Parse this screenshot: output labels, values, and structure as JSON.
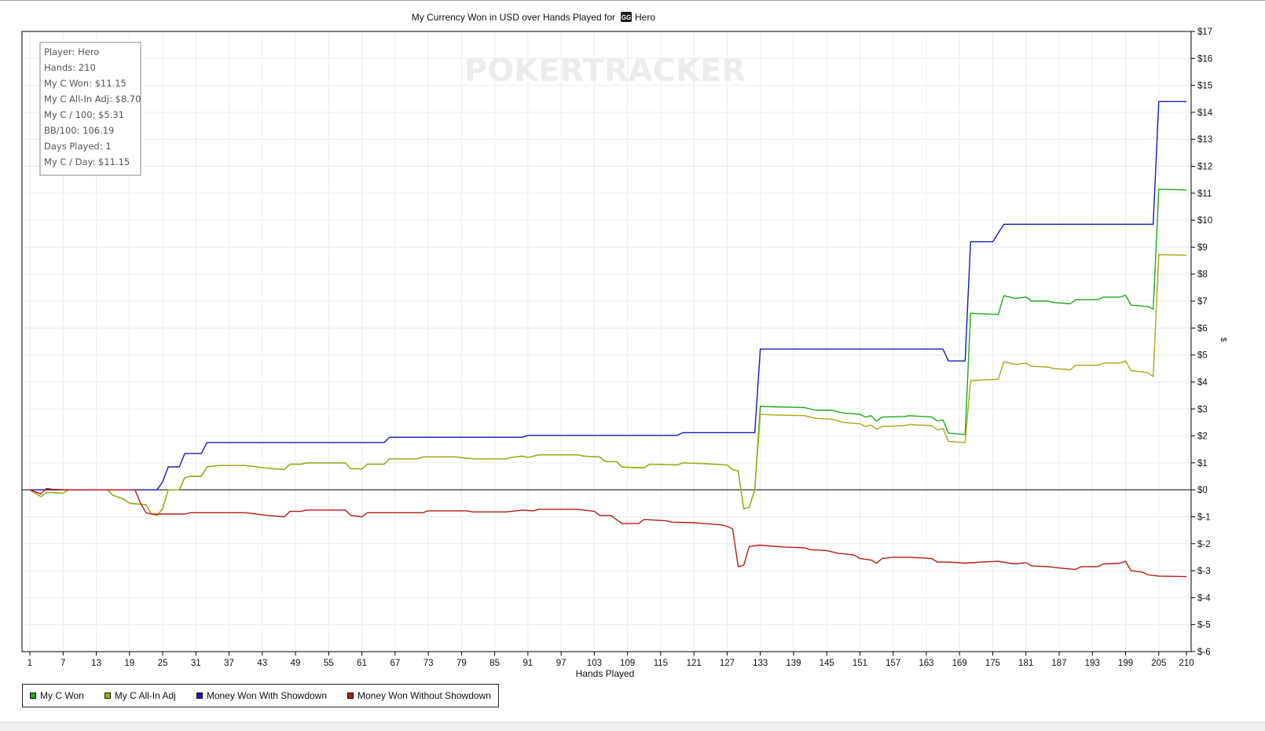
{
  "chart_data": {
    "type": "line",
    "title": "My Currency Won in USD over Hands Played for",
    "title_player": "Hero",
    "watermark": "POKERTRACKER",
    "xlabel": "Hands Played",
    "ylabel": "$",
    "xlim": [
      1,
      210
    ],
    "ylim": [
      -6,
      17
    ],
    "x_ticks": [
      1,
      7,
      13,
      19,
      25,
      31,
      37,
      43,
      49,
      55,
      61,
      67,
      73,
      79,
      85,
      91,
      97,
      103,
      109,
      115,
      121,
      127,
      133,
      139,
      145,
      151,
      157,
      163,
      169,
      175,
      181,
      187,
      193,
      199,
      205,
      210
    ],
    "y_ticks": [
      -6,
      -5,
      -4,
      -3,
      -2,
      -1,
      0,
      1,
      2,
      3,
      4,
      5,
      6,
      7,
      8,
      9,
      10,
      11,
      12,
      13,
      14,
      15,
      16,
      17
    ],
    "y_tick_labels": [
      "$-6",
      "$-5",
      "$-4",
      "$-3",
      "$-2",
      "$-1",
      "$0",
      "$1",
      "$2",
      "$3",
      "$4",
      "$5",
      "$6",
      "$7",
      "$8",
      "$9",
      "$10",
      "$11",
      "$12",
      "$13",
      "$14",
      "$15",
      "$16",
      "$17"
    ],
    "x_tick_labels": [
      "1",
      "7",
      "13",
      "19",
      "25",
      "31",
      "37",
      "43",
      "49",
      "55",
      "61",
      "67",
      "73",
      "79",
      "85",
      "91",
      "97",
      "103",
      "109",
      "115",
      "121",
      "127",
      "133",
      "139",
      "145",
      "151",
      "157",
      "163",
      "169",
      "175",
      "181",
      "187",
      "193",
      "199",
      "205",
      "210"
    ],
    "grid": true,
    "legend_position": "bottom-left",
    "stats_box": [
      "Player: Hero",
      "Hands: 210",
      "My C Won: $11.15",
      "My C All-In Adj: $8.70",
      "My C / 100: $5.31",
      "BB/100: 106.19",
      "Days Played: 1",
      "My C / Day: $11.15"
    ],
    "series": [
      {
        "name": "My C Won",
        "color": "#1fa81f",
        "points": [
          [
            1,
            0
          ],
          [
            3,
            -0.25
          ],
          [
            4,
            -0.1
          ],
          [
            7,
            -0.12
          ],
          [
            8,
            0
          ],
          [
            15,
            0
          ],
          [
            16,
            -0.2
          ],
          [
            18,
            -0.35
          ],
          [
            19,
            -0.5
          ],
          [
            22,
            -0.55
          ],
          [
            23,
            -0.9
          ],
          [
            24,
            -0.95
          ],
          [
            25,
            -0.7
          ],
          [
            26,
            0
          ],
          [
            28,
            0
          ],
          [
            29,
            0.45
          ],
          [
            30,
            0.5
          ],
          [
            32,
            0.5
          ],
          [
            33,
            0.85
          ],
          [
            35,
            0.9
          ],
          [
            40,
            0.9
          ],
          [
            44,
            0.8
          ],
          [
            47,
            0.75
          ],
          [
            48,
            0.95
          ],
          [
            50,
            0.95
          ],
          [
            51,
            1
          ],
          [
            58,
            1
          ],
          [
            59,
            0.78
          ],
          [
            61,
            0.78
          ],
          [
            62,
            0.95
          ],
          [
            65,
            0.95
          ],
          [
            66,
            1.15
          ],
          [
            71,
            1.15
          ],
          [
            72,
            1.22
          ],
          [
            78,
            1.22
          ],
          [
            81,
            1.15
          ],
          [
            87,
            1.15
          ],
          [
            88,
            1.2
          ],
          [
            90,
            1.25
          ],
          [
            91,
            1.2
          ],
          [
            93,
            1.3
          ],
          [
            100,
            1.3
          ],
          [
            101,
            1.25
          ],
          [
            104,
            1.22
          ],
          [
            105,
            1.05
          ],
          [
            107,
            1.05
          ],
          [
            108,
            0.85
          ],
          [
            110,
            0.82
          ],
          [
            112,
            0.82
          ],
          [
            113,
            0.95
          ],
          [
            118,
            0.92
          ],
          [
            119,
            1.0
          ],
          [
            122,
            0.98
          ],
          [
            127,
            0.92
          ],
          [
            128,
            0.75
          ],
          [
            129,
            0.7
          ],
          [
            130,
            -0.7
          ],
          [
            131,
            -0.65
          ],
          [
            132,
            0
          ],
          [
            133,
            3.1
          ],
          [
            135,
            3.08
          ],
          [
            141,
            3.05
          ],
          [
            143,
            2.95
          ],
          [
            146,
            2.95
          ],
          [
            148,
            2.85
          ],
          [
            151,
            2.8
          ],
          [
            152,
            2.7
          ],
          [
            153,
            2.75
          ],
          [
            154,
            2.55
          ],
          [
            155,
            2.7
          ],
          [
            159,
            2.72
          ],
          [
            160,
            2.75
          ],
          [
            164,
            2.7
          ],
          [
            165,
            2.55
          ],
          [
            166,
            2.6
          ],
          [
            167,
            2.1
          ],
          [
            170,
            2.05
          ],
          [
            171,
            6.55
          ],
          [
            176,
            6.5
          ],
          [
            177,
            7.2
          ],
          [
            179,
            7.1
          ],
          [
            181,
            7.15
          ],
          [
            182,
            7.0
          ],
          [
            185,
            7.0
          ],
          [
            186,
            6.95
          ],
          [
            189,
            6.9
          ],
          [
            190,
            7.05
          ],
          [
            194,
            7.05
          ],
          [
            195,
            7.15
          ],
          [
            198,
            7.15
          ],
          [
            199,
            7.22
          ],
          [
            200,
            6.85
          ],
          [
            203,
            6.8
          ],
          [
            204,
            6.7
          ],
          [
            205,
            11.15
          ],
          [
            210,
            11.12
          ]
        ]
      },
      {
        "name": "My C All-In Adj",
        "color": "#a8a812",
        "points": [
          [
            1,
            0
          ],
          [
            3,
            -0.25
          ],
          [
            4,
            -0.1
          ],
          [
            7,
            -0.12
          ],
          [
            8,
            0
          ],
          [
            15,
            0
          ],
          [
            16,
            -0.2
          ],
          [
            18,
            -0.35
          ],
          [
            19,
            -0.5
          ],
          [
            22,
            -0.55
          ],
          [
            23,
            -0.9
          ],
          [
            24,
            -0.95
          ],
          [
            25,
            -0.7
          ],
          [
            26,
            0
          ],
          [
            28,
            0
          ],
          [
            29,
            0.45
          ],
          [
            30,
            0.5
          ],
          [
            32,
            0.5
          ],
          [
            33,
            0.85
          ],
          [
            35,
            0.9
          ],
          [
            40,
            0.9
          ],
          [
            44,
            0.8
          ],
          [
            47,
            0.75
          ],
          [
            48,
            0.95
          ],
          [
            50,
            0.95
          ],
          [
            51,
            1
          ],
          [
            58,
            1
          ],
          [
            59,
            0.78
          ],
          [
            61,
            0.78
          ],
          [
            62,
            0.95
          ],
          [
            65,
            0.95
          ],
          [
            66,
            1.15
          ],
          [
            71,
            1.15
          ],
          [
            72,
            1.22
          ],
          [
            78,
            1.22
          ],
          [
            81,
            1.15
          ],
          [
            87,
            1.15
          ],
          [
            88,
            1.2
          ],
          [
            90,
            1.25
          ],
          [
            91,
            1.2
          ],
          [
            93,
            1.3
          ],
          [
            100,
            1.3
          ],
          [
            101,
            1.25
          ],
          [
            104,
            1.22
          ],
          [
            105,
            1.05
          ],
          [
            107,
            1.05
          ],
          [
            108,
            0.85
          ],
          [
            110,
            0.82
          ],
          [
            112,
            0.82
          ],
          [
            113,
            0.95
          ],
          [
            118,
            0.92
          ],
          [
            119,
            1.0
          ],
          [
            122,
            0.98
          ],
          [
            127,
            0.92
          ],
          [
            128,
            0.75
          ],
          [
            129,
            0.7
          ],
          [
            130,
            -0.7
          ],
          [
            131,
            -0.65
          ],
          [
            132,
            0
          ],
          [
            133,
            2.8
          ],
          [
            135,
            2.78
          ],
          [
            141,
            2.75
          ],
          [
            143,
            2.65
          ],
          [
            146,
            2.62
          ],
          [
            148,
            2.5
          ],
          [
            151,
            2.45
          ],
          [
            152,
            2.35
          ],
          [
            153,
            2.4
          ],
          [
            154,
            2.25
          ],
          [
            155,
            2.35
          ],
          [
            159,
            2.38
          ],
          [
            160,
            2.42
          ],
          [
            164,
            2.38
          ],
          [
            165,
            2.22
          ],
          [
            166,
            2.28
          ],
          [
            167,
            1.8
          ],
          [
            170,
            1.75
          ],
          [
            171,
            4.05
          ],
          [
            176,
            4.1
          ],
          [
            177,
            4.75
          ],
          [
            179,
            4.65
          ],
          [
            181,
            4.7
          ],
          [
            182,
            4.58
          ],
          [
            185,
            4.55
          ],
          [
            186,
            4.5
          ],
          [
            189,
            4.45
          ],
          [
            190,
            4.62
          ],
          [
            194,
            4.62
          ],
          [
            195,
            4.7
          ],
          [
            198,
            4.7
          ],
          [
            199,
            4.78
          ],
          [
            200,
            4.42
          ],
          [
            203,
            4.35
          ],
          [
            204,
            4.2
          ],
          [
            205,
            8.72
          ],
          [
            210,
            8.7
          ]
        ]
      },
      {
        "name": "Money Won With Showdown",
        "color": "#1a1ab4",
        "points": [
          [
            1,
            0
          ],
          [
            24,
            0
          ],
          [
            25,
            0.3
          ],
          [
            26,
            0.85
          ],
          [
            28,
            0.85
          ],
          [
            29,
            1.35
          ],
          [
            32,
            1.35
          ],
          [
            33,
            1.75
          ],
          [
            65,
            1.75
          ],
          [
            66,
            1.95
          ],
          [
            90,
            1.95
          ],
          [
            91,
            2.02
          ],
          [
            118,
            2.02
          ],
          [
            119,
            2.12
          ],
          [
            132,
            2.12
          ],
          [
            133,
            5.22
          ],
          [
            166,
            5.22
          ],
          [
            167,
            4.78
          ],
          [
            170,
            4.78
          ],
          [
            171,
            9.2
          ],
          [
            175,
            9.2
          ],
          [
            177,
            9.85
          ],
          [
            204,
            9.85
          ],
          [
            205,
            14.4
          ],
          [
            210,
            14.4
          ]
        ]
      },
      {
        "name": "Money Won Without Showdown",
        "color": "#b41a1a",
        "points": [
          [
            1,
            0
          ],
          [
            3,
            -0.15
          ],
          [
            4,
            0.05
          ],
          [
            5,
            0.02
          ],
          [
            8,
            0
          ],
          [
            20,
            0
          ],
          [
            21,
            -0.5
          ],
          [
            22,
            -0.85
          ],
          [
            23,
            -0.9
          ],
          [
            29,
            -0.9
          ],
          [
            30,
            -0.85
          ],
          [
            40,
            -0.85
          ],
          [
            44,
            -0.95
          ],
          [
            47,
            -1.0
          ],
          [
            48,
            -0.8
          ],
          [
            50,
            -0.8
          ],
          [
            51,
            -0.75
          ],
          [
            58,
            -0.75
          ],
          [
            59,
            -0.95
          ],
          [
            61,
            -1.0
          ],
          [
            62,
            -0.85
          ],
          [
            72,
            -0.85
          ],
          [
            73,
            -0.78
          ],
          [
            80,
            -0.78
          ],
          [
            81,
            -0.82
          ],
          [
            87,
            -0.82
          ],
          [
            90,
            -0.75
          ],
          [
            92,
            -0.78
          ],
          [
            93,
            -0.72
          ],
          [
            100,
            -0.72
          ],
          [
            103,
            -0.8
          ],
          [
            104,
            -0.95
          ],
          [
            106,
            -0.95
          ],
          [
            107,
            -1.1
          ],
          [
            108,
            -1.25
          ],
          [
            111,
            -1.25
          ],
          [
            112,
            -1.1
          ],
          [
            116,
            -1.15
          ],
          [
            117,
            -1.2
          ],
          [
            121,
            -1.22
          ],
          [
            126,
            -1.3
          ],
          [
            127,
            -1.35
          ],
          [
            128,
            -1.45
          ],
          [
            129,
            -2.85
          ],
          [
            130,
            -2.8
          ],
          [
            131,
            -2.1
          ],
          [
            133,
            -2.05
          ],
          [
            137,
            -2.12
          ],
          [
            141,
            -2.15
          ],
          [
            142,
            -2.22
          ],
          [
            145,
            -2.25
          ],
          [
            147,
            -2.35
          ],
          [
            150,
            -2.42
          ],
          [
            151,
            -2.55
          ],
          [
            153,
            -2.6
          ],
          [
            154,
            -2.72
          ],
          [
            155,
            -2.55
          ],
          [
            157,
            -2.5
          ],
          [
            160,
            -2.5
          ],
          [
            164,
            -2.55
          ],
          [
            165,
            -2.68
          ],
          [
            167,
            -2.68
          ],
          [
            170,
            -2.72
          ],
          [
            173,
            -2.68
          ],
          [
            176,
            -2.65
          ],
          [
            179,
            -2.75
          ],
          [
            181,
            -2.7
          ],
          [
            182,
            -2.82
          ],
          [
            185,
            -2.85
          ],
          [
            188,
            -2.92
          ],
          [
            190,
            -2.95
          ],
          [
            191,
            -2.85
          ],
          [
            194,
            -2.85
          ],
          [
            195,
            -2.75
          ],
          [
            198,
            -2.72
          ],
          [
            199,
            -2.65
          ],
          [
            200,
            -3.0
          ],
          [
            202,
            -3.05
          ],
          [
            203,
            -3.15
          ],
          [
            205,
            -3.2
          ],
          [
            210,
            -3.22
          ]
        ]
      }
    ]
  }
}
